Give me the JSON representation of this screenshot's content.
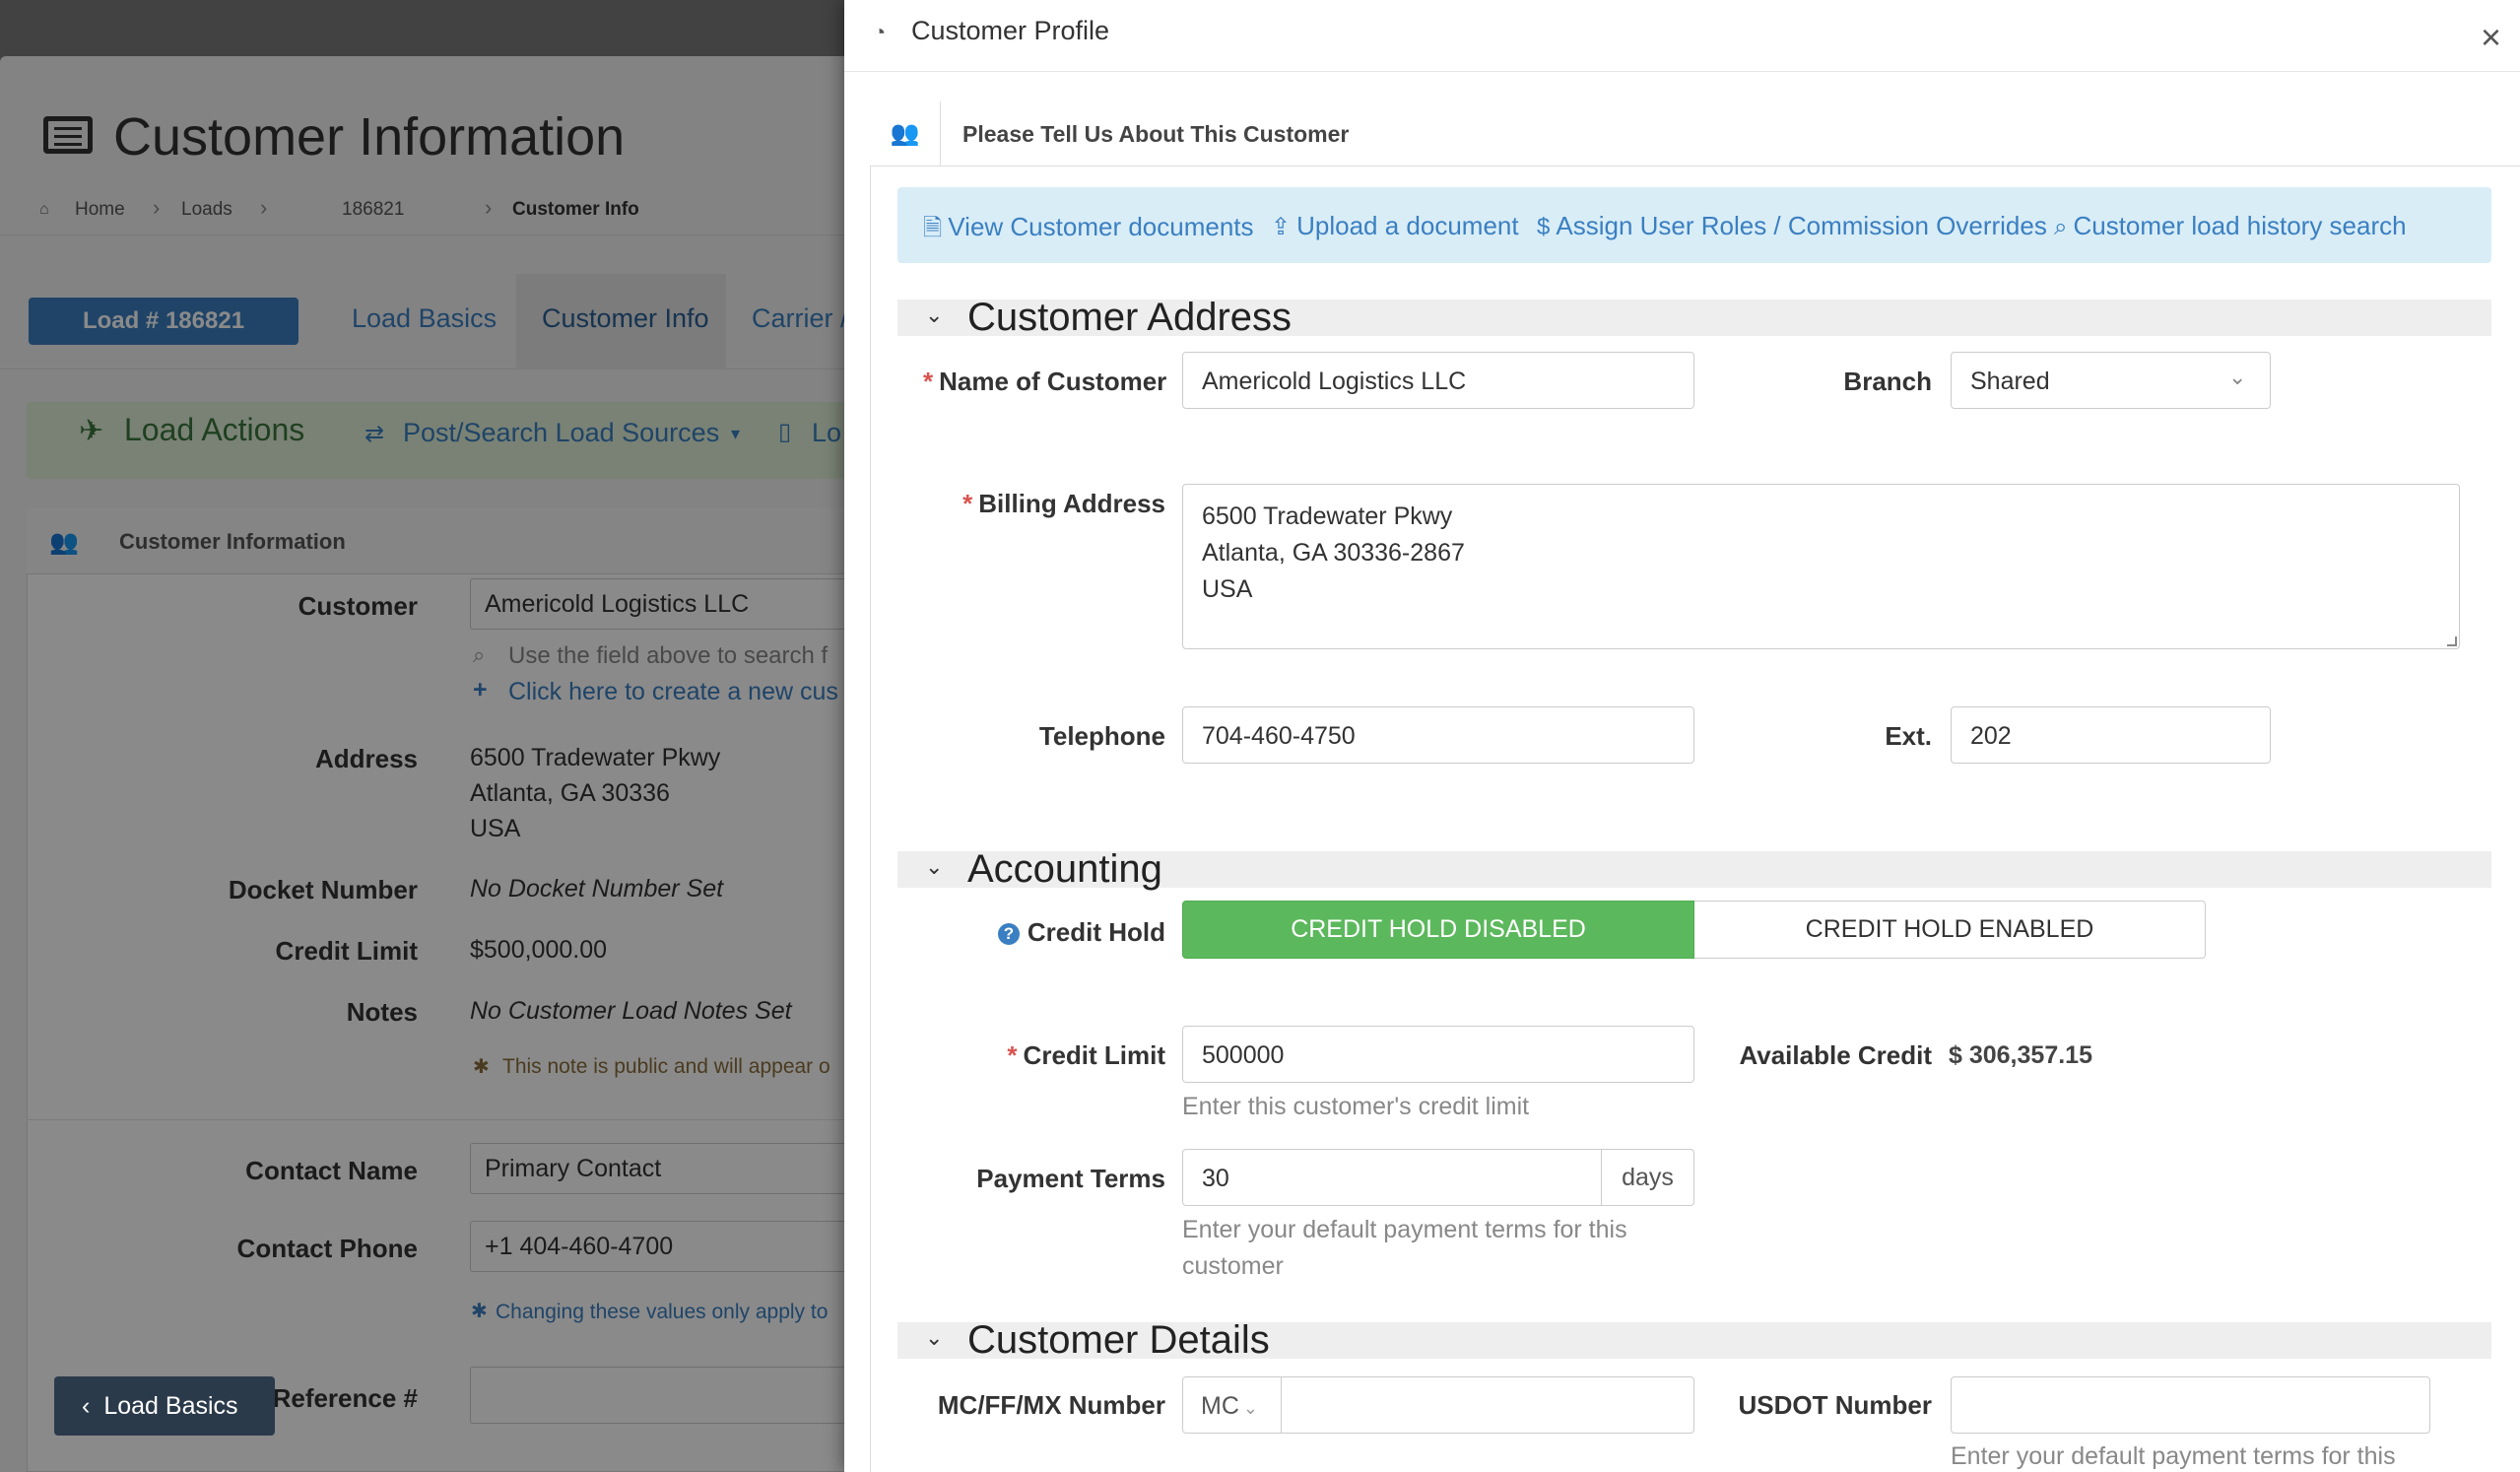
{
  "background": {
    "page_title": "Customer Information",
    "breadcrumb": {
      "home": "Home",
      "loads": "Loads",
      "load_id": "186821",
      "current": "Customer Info"
    },
    "load_badge": "Load # 186821",
    "tabs": [
      "Load Basics",
      "Customer Info",
      "Carrier /"
    ],
    "actions_title": "Load Actions",
    "actions_link1": "Post/Search Load Sources",
    "actions_link2": "Lo",
    "panel_title": "Customer Information",
    "customer_label": "Customer",
    "customer_value": "Americold Logistics LLC",
    "search_hint": "Use the field above to search f",
    "create_link": "Click here to create a new cus",
    "address_label": "Address",
    "address_line1": "6500 Tradewater Pkwy",
    "address_line2": "Atlanta, GA 30336",
    "address_line3": "USA",
    "docket_label": "Docket Number",
    "docket_value": "No Docket Number Set",
    "credit_limit_label": "Credit Limit",
    "credit_limit_value": "$500,000.00",
    "notes_label": "Notes",
    "notes_value": "No Customer Load Notes Set",
    "notes_public": "This note is public and will appear o",
    "contact_name_label": "Contact Name",
    "contact_name_value": "Primary Contact",
    "contact_phone_label": "Contact Phone",
    "contact_phone_value": "+1 404-460-4700",
    "changing_note": "Changing these values only apply to",
    "reference_label": "Reference #",
    "back_button": "Load Basics"
  },
  "modal": {
    "title": "Customer Profile",
    "panel_title": "Please Tell Us About This Customer",
    "links": {
      "view_docs": "View Customer documents",
      "upload": "Upload a document",
      "roles": "Assign User Roles / Commission Overrides",
      "history": "Customer load history search"
    },
    "address_section": {
      "title": "Customer Address",
      "name_label": "Name of Customer",
      "name_value": "Americold Logistics LLC",
      "branch_label": "Branch",
      "branch_value": "Shared",
      "billing_label": "Billing Address",
      "billing_line1": "6500 Tradewater Pkwy",
      "billing_line2": "Atlanta, GA 30336-2867",
      "billing_line3": "USA",
      "telephone_label": "Telephone",
      "telephone_value": "704-460-4750",
      "ext_label": "Ext.",
      "ext_value": "202"
    },
    "accounting_section": {
      "title": "Accounting",
      "credit_hold_label": "Credit Hold",
      "credit_hold_disabled": "CREDIT HOLD DISABLED",
      "credit_hold_enabled": "CREDIT HOLD ENABLED",
      "credit_limit_label": "Credit Limit",
      "credit_limit_value": "500000",
      "credit_limit_hint": "Enter this customer's credit limit",
      "available_credit_label": "Available Credit",
      "available_credit_value": "$ 306,357.15",
      "payment_terms_label": "Payment Terms",
      "payment_terms_value": "30",
      "payment_terms_unit": "days",
      "payment_terms_hint_line1": "Enter your default payment terms for this",
      "payment_terms_hint_line2": "customer"
    },
    "details_section": {
      "title": "Customer Details",
      "mc_label": "MC/FF/MX Number",
      "mc_prefix": "MC",
      "mc_value": "",
      "usdot_label": "USDOT Number",
      "usdot_value": "",
      "usdot_hint": "Enter your default payment terms for this"
    }
  },
  "colors": {
    "accent_blue": "#3a7fc1",
    "success_green": "#5cb85c",
    "required_red": "#d9534f",
    "info_bg": "#d9edf7"
  }
}
